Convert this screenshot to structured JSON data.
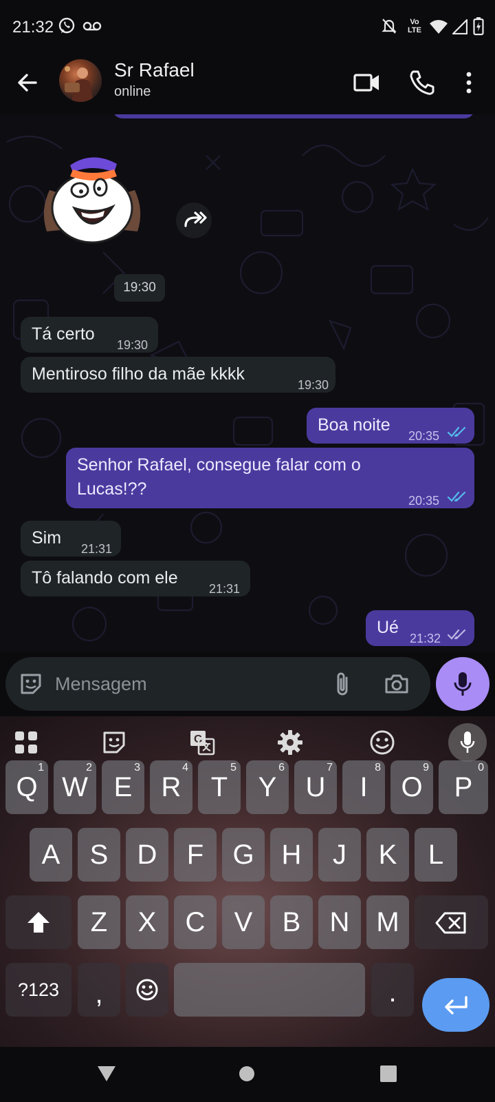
{
  "status_bar": {
    "time": "21:32",
    "icons": [
      "whatsapp-icon",
      "voicemail-icon",
      "notifications-off-icon",
      "volte-icon",
      "wifi-icon",
      "signal-icon",
      "battery-charging-icon"
    ],
    "volte_label_top": "Vo",
    "volte_label_bottom": "LTE"
  },
  "header": {
    "contact_name": "Sr Rafael",
    "status": "online",
    "actions": [
      "video-call-icon",
      "voice-call-icon",
      "more-options-icon"
    ]
  },
  "chat": {
    "date_chip": "19:30",
    "messages": [
      {
        "direction": "in",
        "text": "Tá certo",
        "time": "19:30"
      },
      {
        "direction": "in",
        "text": "Mentiroso filho da mãe kkkk",
        "time": "19:30"
      },
      {
        "direction": "out",
        "text": "Boa noite",
        "time": "20:35",
        "status": "read"
      },
      {
        "direction": "out",
        "text": "Senhor Rafael, consegue falar com o Lucas!??",
        "time": "20:35",
        "status": "read"
      },
      {
        "direction": "in",
        "text": "Sim",
        "time": "21:31"
      },
      {
        "direction": "in",
        "text": "Tô falando com ele",
        "time": "21:31"
      },
      {
        "direction": "out",
        "text": "Ué",
        "time": "21:32",
        "status": "delivered"
      }
    ]
  },
  "composer": {
    "placeholder": "Mensagem",
    "icons": [
      "sticker-icon",
      "attach-icon",
      "camera-icon",
      "mic-icon"
    ]
  },
  "keyboard": {
    "toolbar": [
      "apps-grid-icon",
      "sticker-icon",
      "translate-icon",
      "settings-icon",
      "emoji-icon",
      "voice-input-icon"
    ],
    "row1": [
      "Q",
      "W",
      "E",
      "R",
      "T",
      "Y",
      "U",
      "I",
      "O",
      "P"
    ],
    "row1_hints": [
      "1",
      "2",
      "3",
      "4",
      "5",
      "6",
      "7",
      "8",
      "9",
      "0"
    ],
    "row2": [
      "A",
      "S",
      "D",
      "F",
      "G",
      "H",
      "J",
      "K",
      "L"
    ],
    "row3": [
      "Z",
      "X",
      "C",
      "V",
      "B",
      "N",
      "M"
    ],
    "symbols_key": "?123",
    "comma_key": ",",
    "period_key": "."
  },
  "colors": {
    "incoming_bubble": "#1f2427",
    "outgoing_bubble": "#4b3a9e",
    "mic_button": "#a98cf5",
    "enter_key": "#5b9cf2",
    "read_ticks": "#53bdeb"
  }
}
